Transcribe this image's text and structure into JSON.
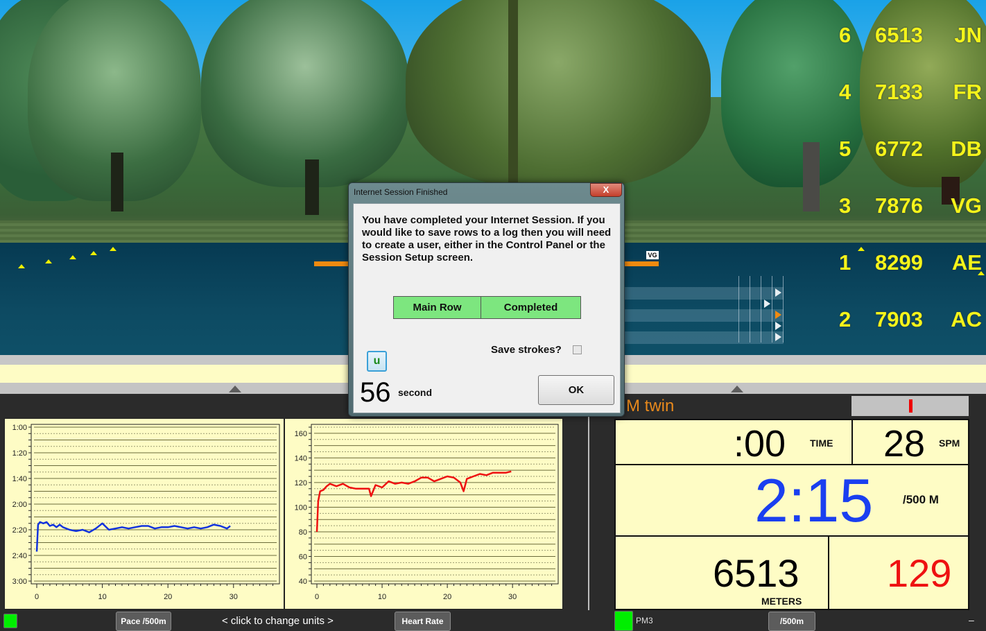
{
  "leaderboard": [
    {
      "position": "6",
      "distance": "6513",
      "initials": "JN"
    },
    {
      "position": "4",
      "distance": "7133",
      "initials": "FR"
    },
    {
      "position": "5",
      "distance": "6772",
      "initials": "DB"
    },
    {
      "position": "3",
      "distance": "7876",
      "initials": "VG"
    },
    {
      "position": "1",
      "distance": "8299",
      "initials": "AE"
    },
    {
      "position": "2",
      "distance": "7903",
      "initials": "AC"
    }
  ],
  "scene": {
    "boat_tag": "VG"
  },
  "dialog": {
    "title": "Internet Session Finished",
    "close_label": "X",
    "message": "You have completed your Internet Session.  If you would like to save rows to a log then you will need to create a user, either in the Control Panel or the Session Setup screen.",
    "status_row": {
      "name": "Main Row",
      "status": "Completed"
    },
    "save_strokes_label": "Save strokes?",
    "save_strokes_checked": false,
    "u_button_label": "u",
    "countdown_value": "56",
    "countdown_unit": "second",
    "ok_label": "OK"
  },
  "monitor": {
    "title": "M twin",
    "time_value": ":00",
    "time_unit": "TIME",
    "spm_value": "28",
    "spm_unit": "SPM",
    "pace_value": "2:15",
    "pace_unit": "/500 M",
    "meters_value": "6513",
    "meters_unit": "METERS",
    "heart_rate_value": "129",
    "colors": {
      "pace": "#1a3ff0",
      "heart_rate": "#ee1111",
      "title": "#e8891c"
    }
  },
  "bottom_bar": {
    "pace_button": "Pace /500m",
    "hint": "<  click to change units  >",
    "heart_rate_button": "Heart Rate",
    "pm_label": "PM3",
    "unit_button": "/500m",
    "minimize": "–"
  },
  "chart_data": [
    {
      "type": "line",
      "title": "Pace /500m",
      "xlabel": "",
      "ylabel": "",
      "x_ticks": [
        "0",
        "10",
        "20",
        "30"
      ],
      "y_ticks": [
        "1:00",
        "1:20",
        "1:40",
        "2:00",
        "2:20",
        "2:40",
        "3:00"
      ],
      "xlim": [
        0,
        37
      ],
      "ylim_seconds": [
        60,
        180
      ],
      "y_inverted": true,
      "grid": true,
      "series": [
        {
          "name": "Pace",
          "color": "#1133dd",
          "x": [
            0,
            0.2,
            0.5,
            1,
            1.5,
            2,
            2.5,
            3,
            3.5,
            4,
            5,
            6,
            7,
            8,
            9,
            10,
            11,
            12,
            13,
            14,
            15,
            16,
            17,
            18,
            19,
            20,
            21,
            22,
            23,
            24,
            25,
            26,
            27,
            28,
            29,
            29.5
          ],
          "y_seconds": [
            157,
            136,
            134,
            135,
            134,
            137,
            136,
            138,
            136,
            138,
            140,
            141,
            140,
            142,
            139,
            135,
            140,
            139,
            138,
            139,
            138,
            137,
            137,
            139,
            138,
            138,
            137,
            138,
            139,
            138,
            139,
            138,
            136,
            137,
            139,
            137
          ]
        }
      ]
    },
    {
      "type": "line",
      "title": "Heart Rate",
      "xlabel": "",
      "ylabel": "",
      "x_ticks": [
        "0",
        "10",
        "20",
        "30"
      ],
      "y_ticks": [
        "160",
        "140",
        "120",
        "100",
        "80",
        "60",
        "40"
      ],
      "xlim": [
        0,
        37
      ],
      "ylim": [
        40,
        165
      ],
      "grid": true,
      "series": [
        {
          "name": "Heart Rate",
          "color": "#ee1111",
          "x": [
            0,
            0.2,
            0.5,
            1,
            1.5,
            2,
            3,
            4,
            5,
            6,
            7,
            8,
            8.3,
            9,
            10,
            11,
            12,
            13,
            14,
            15,
            16,
            17,
            18,
            19,
            20,
            21,
            22,
            22.5,
            23,
            24,
            25,
            26,
            27,
            28,
            29,
            29.8
          ],
          "values": [
            80,
            105,
            113,
            114,
            117,
            119,
            117,
            119,
            116,
            115,
            115,
            115,
            109,
            118,
            116,
            121,
            119,
            120,
            119,
            121,
            124,
            124,
            121,
            123,
            125,
            124,
            120,
            113,
            123,
            125,
            127,
            126,
            128,
            128,
            128,
            129
          ]
        }
      ]
    }
  ]
}
